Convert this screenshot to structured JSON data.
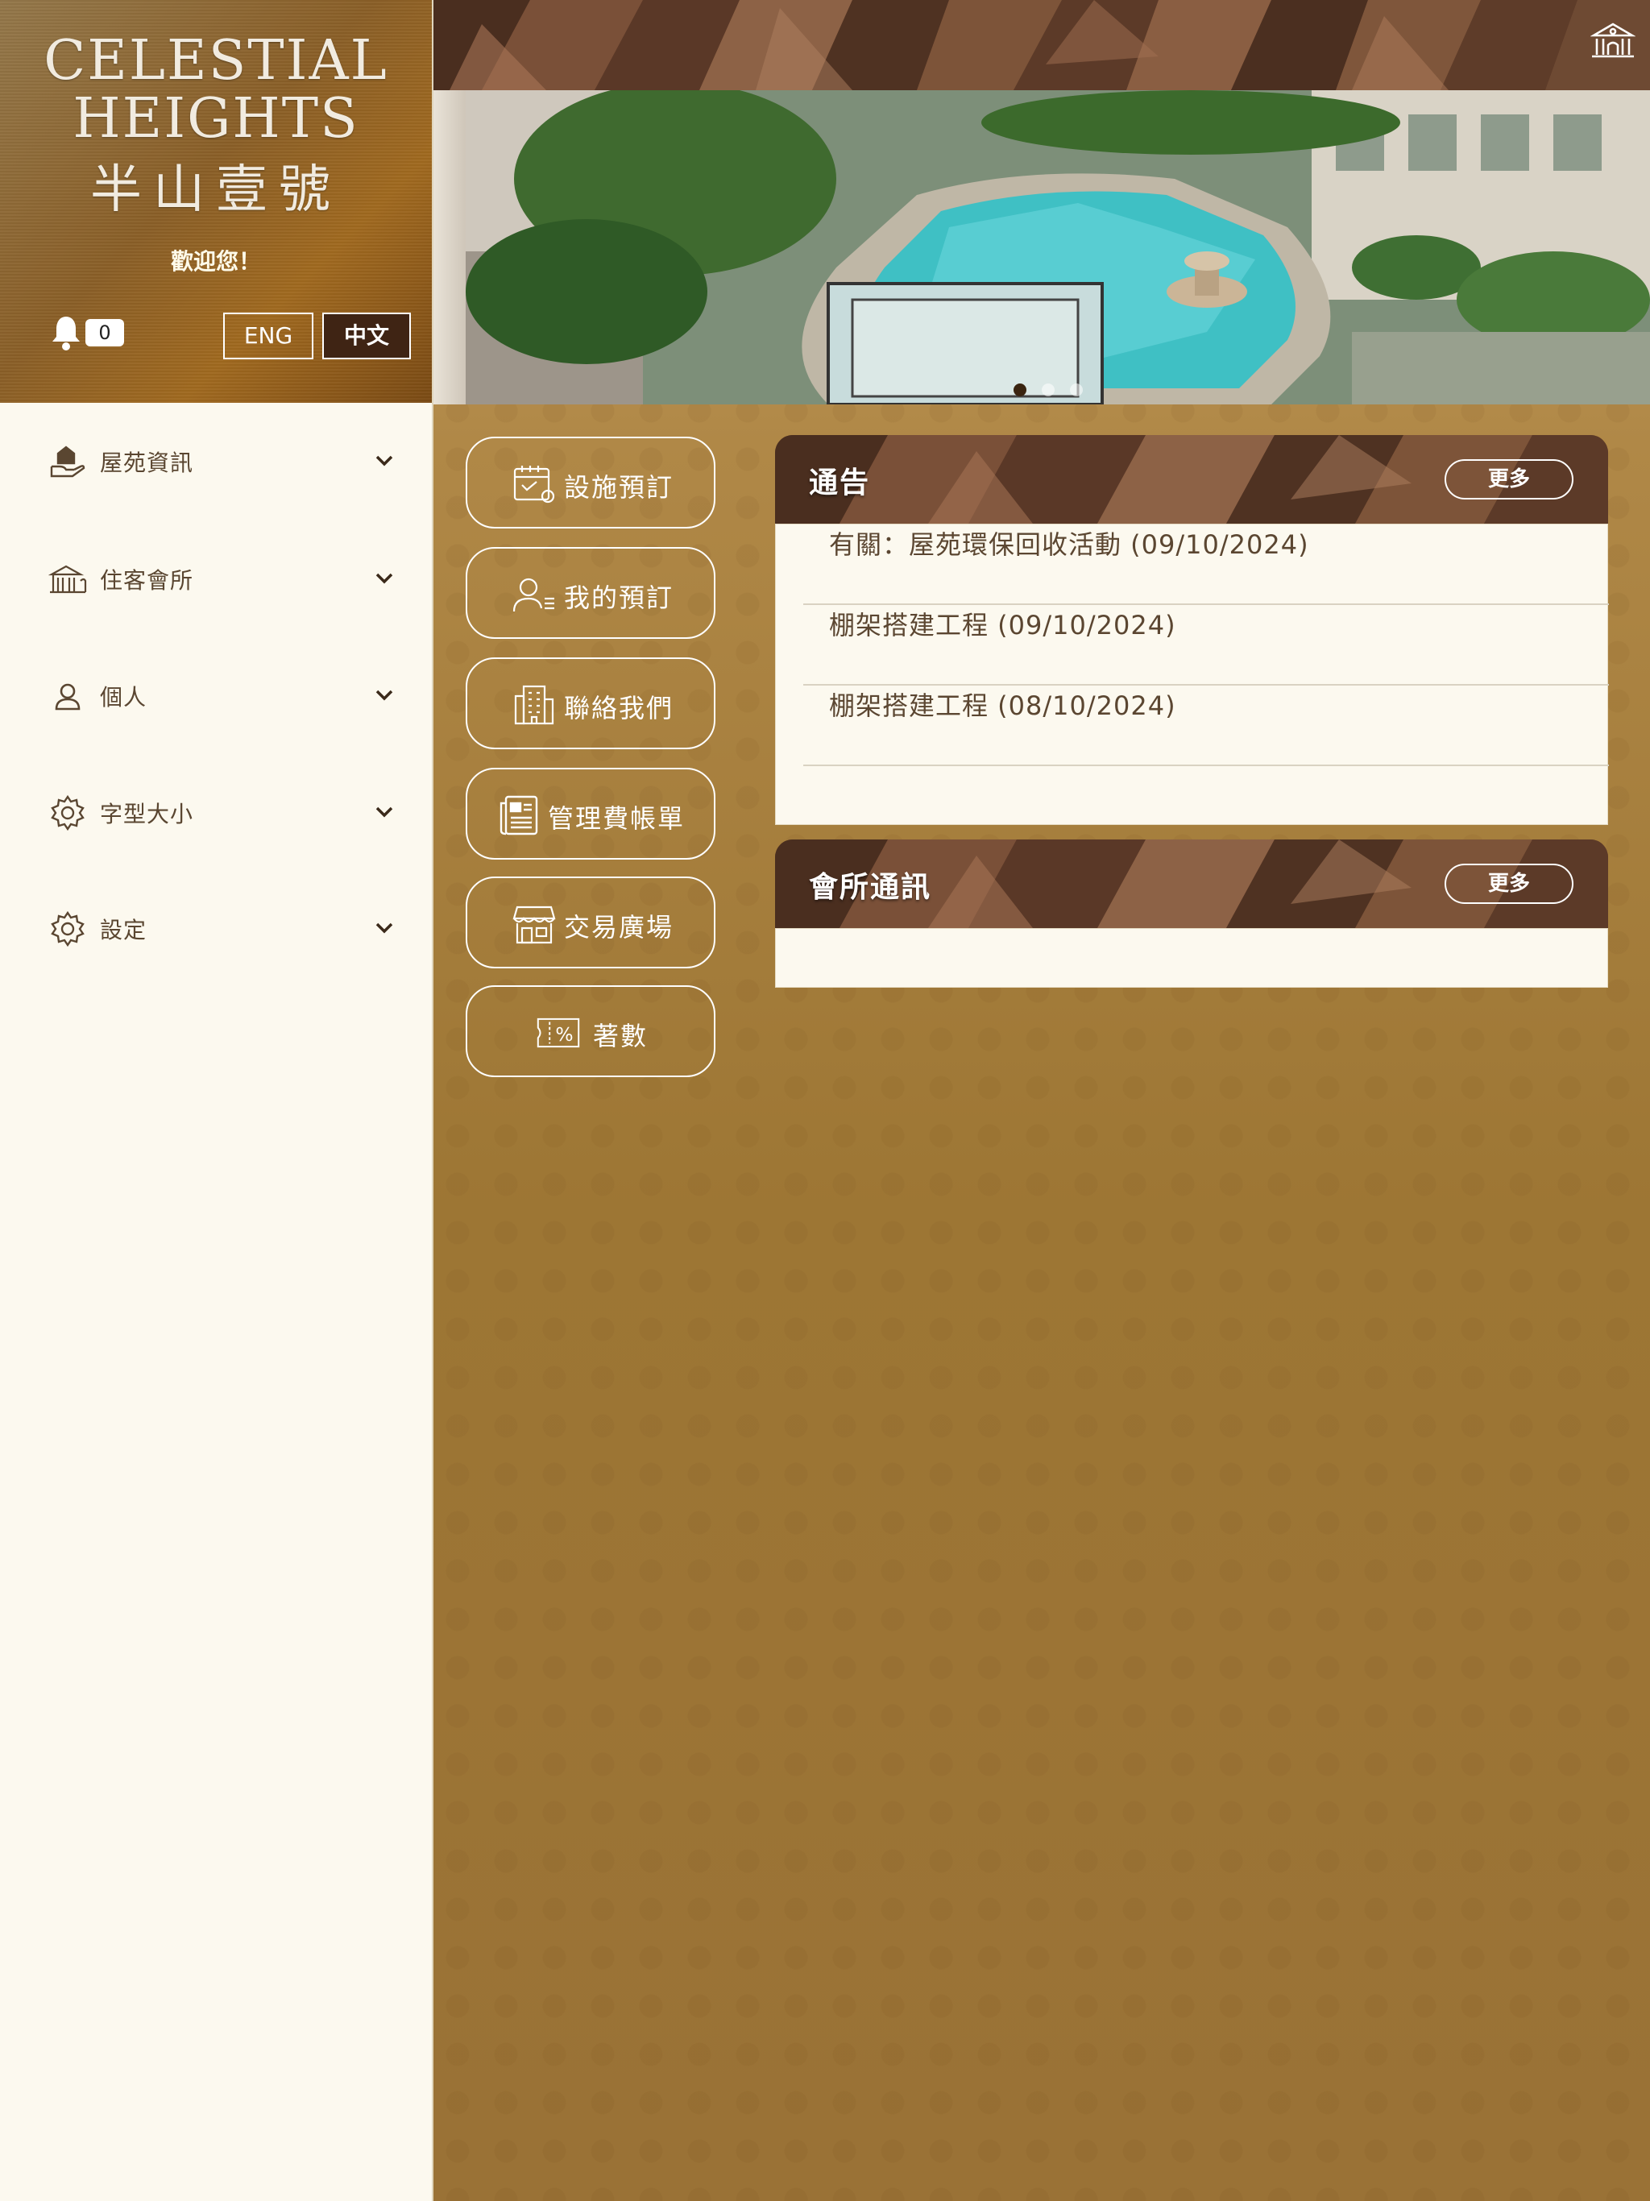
{
  "brand": {
    "logo_line1": "CELESTIAL",
    "logo_line2": "HEIGHTS",
    "logo_zh": "半山壹號",
    "welcome": "歡迎您！",
    "notification_count": "0"
  },
  "language": {
    "eng": "ENG",
    "zh": "中文",
    "active": "中文"
  },
  "sidebar": {
    "items": [
      {
        "label": "屋苑資訊",
        "icon": "house-hand-icon"
      },
      {
        "label": "住客會所",
        "icon": "clubhouse-icon"
      },
      {
        "label": "個人",
        "icon": "user-icon"
      },
      {
        "label": "字型大小",
        "icon": "gear-icon"
      },
      {
        "label": "設定",
        "icon": "gear-icon"
      }
    ]
  },
  "banner": {
    "slides": 3,
    "active_slide": 1
  },
  "quick_actions": [
    {
      "label": "設施預訂",
      "icon": "calendar-check-icon"
    },
    {
      "label": "我的預訂",
      "icon": "user-list-icon"
    },
    {
      "label": "聯絡我們",
      "icon": "building-icon"
    },
    {
      "label": "管理費帳單",
      "icon": "newspaper-icon"
    },
    {
      "label": "交易廣場",
      "icon": "storefront-icon"
    },
    {
      "label": "著數",
      "icon": "coupon-percent-icon"
    }
  ],
  "notices": {
    "title": "通告",
    "more": "更多",
    "items": [
      "有關：屋苑環保回收活動 (09/10/2024)",
      "棚架搭建工程 (09/10/2024)",
      "棚架搭建工程 (08/10/2024)"
    ]
  },
  "club_news": {
    "title": "會所通訊",
    "more": "更多",
    "items": []
  },
  "colors": {
    "header_brown": "#5e3c27",
    "sidebar_bg": "#fcf9ef",
    "gold_bg": "#9d7634",
    "active_lang_bg": "#3f2414"
  }
}
